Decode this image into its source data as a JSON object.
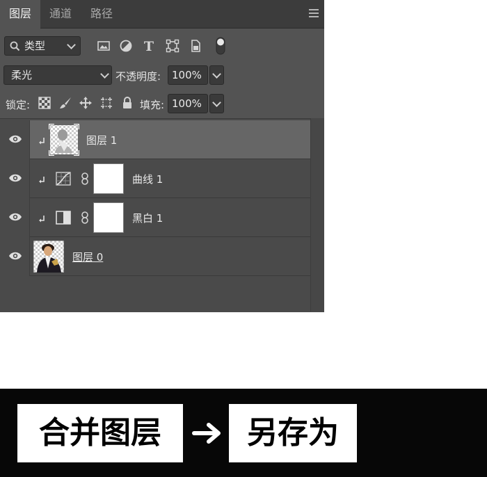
{
  "tabs": [
    {
      "label": "图层",
      "active": true
    },
    {
      "label": "通道",
      "active": false
    },
    {
      "label": "路径",
      "active": false
    }
  ],
  "filter": {
    "kind_label": "类型"
  },
  "blend": {
    "mode": "柔光",
    "opacity_label": "不透明度:",
    "opacity_value": "100%"
  },
  "lock": {
    "label": "锁定:",
    "fill_label": "填充:",
    "fill_value": "100%"
  },
  "layers": [
    {
      "name": "图层 1",
      "selected": true,
      "clipped": true,
      "kind": "pixel"
    },
    {
      "name": "曲线 1",
      "selected": false,
      "clipped": true,
      "kind": "curves-adjustment"
    },
    {
      "name": "黑白 1",
      "selected": false,
      "clipped": true,
      "kind": "black-white-adjustment"
    },
    {
      "name": "图层 0",
      "selected": false,
      "clipped": false,
      "kind": "pixel"
    }
  ],
  "banner": {
    "step1": "合并图层",
    "step2": "另存为"
  },
  "colors": {
    "panel_bg": "#535353",
    "tabbar_bg": "#3c3c3c",
    "selected_row": "#666666",
    "banner_bg": "#070707"
  }
}
